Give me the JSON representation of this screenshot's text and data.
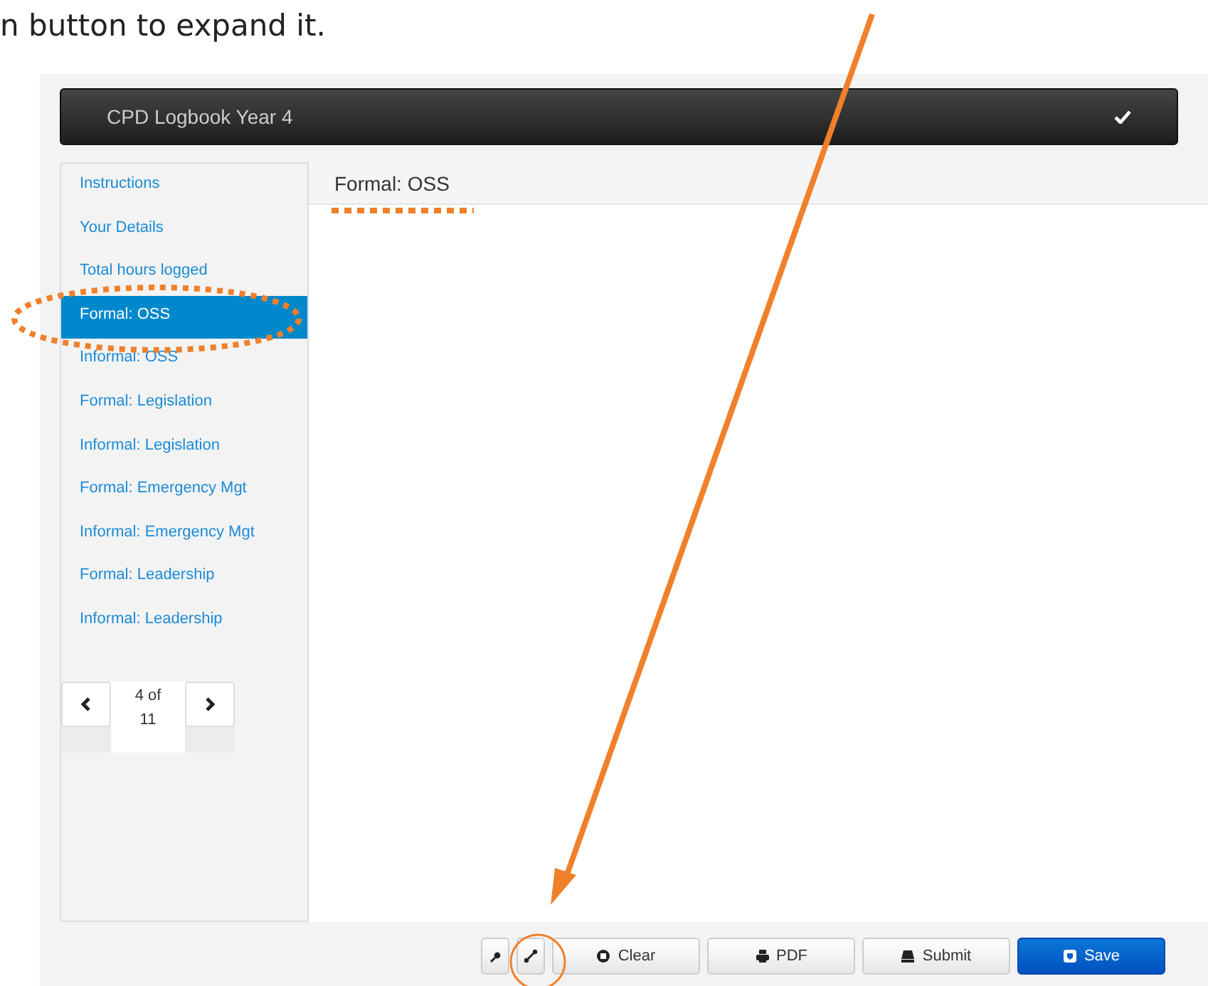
{
  "caption": "n button to expand it.",
  "app_title": "CPD Logbook Year 4",
  "nav_items": [
    {
      "label": "Instructions",
      "selected": false
    },
    {
      "label": "Your Details",
      "selected": false
    },
    {
      "label": "Total hours logged",
      "selected": false
    },
    {
      "label": "Formal: OSS",
      "selected": true
    },
    {
      "label": "Informal: OSS",
      "selected": false
    },
    {
      "label": "Formal: Legislation",
      "selected": false
    },
    {
      "label": "Informal: Legislation",
      "selected": false
    },
    {
      "label": "Formal: Emergency Mgt",
      "selected": false
    },
    {
      "label": "Informal: Emergency Mgt",
      "selected": false
    },
    {
      "label": "Formal: Leadership",
      "selected": false
    },
    {
      "label": "Informal: Leadership",
      "selected": false
    }
  ],
  "pager": {
    "label": "4 of 11"
  },
  "page_heading": "Formal: OSS",
  "toolbar": [
    {
      "kind": "pin",
      "primary": false
    },
    {
      "kind": "expand",
      "primary": false
    },
    {
      "kind": "clear",
      "label": "Clear",
      "primary": false
    },
    {
      "kind": "print",
      "label": "PDF",
      "primary": false
    },
    {
      "kind": "submit",
      "label": "Submit",
      "primary": false
    },
    {
      "kind": "save",
      "label": "Save",
      "primary": true
    }
  ]
}
